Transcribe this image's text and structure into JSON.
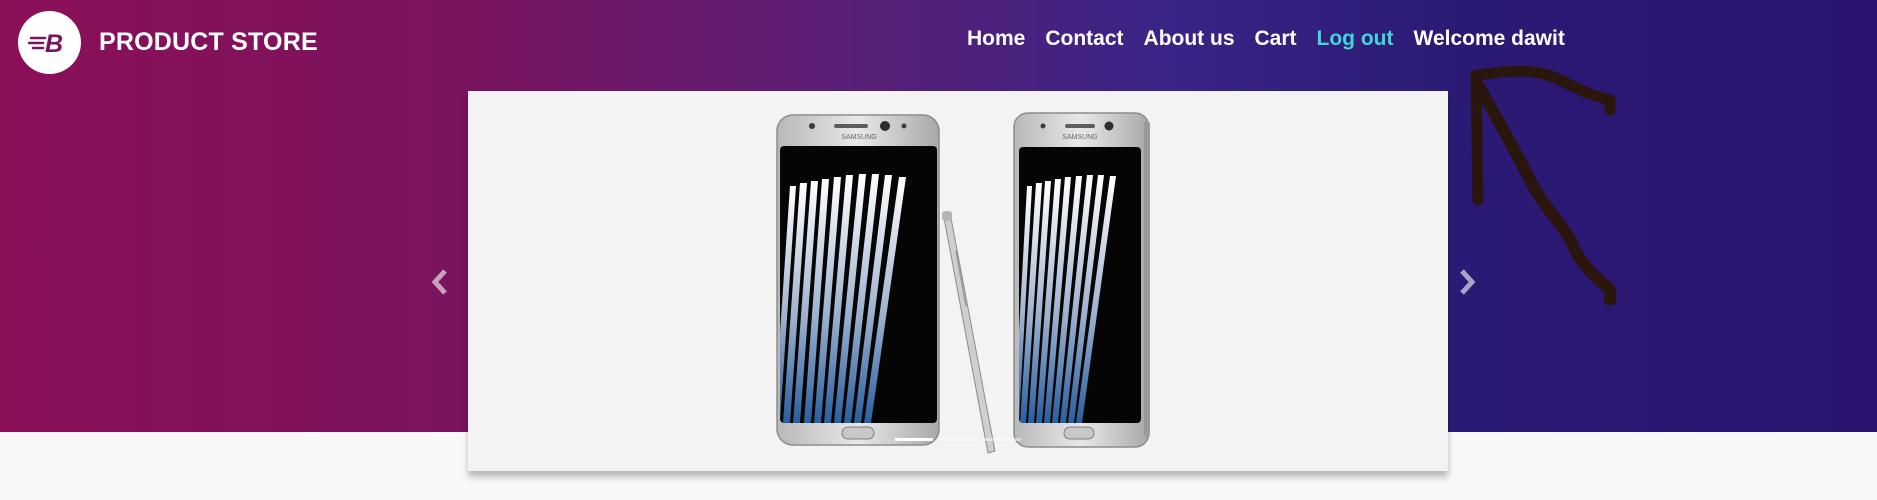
{
  "brand": {
    "name": "PRODUCT STORE",
    "logo_icon": "brand-b-icon",
    "logo_letter": "B"
  },
  "nav": {
    "items": [
      {
        "label": "Home"
      },
      {
        "label": "Contact"
      },
      {
        "label": "About us"
      },
      {
        "label": "Cart"
      },
      {
        "label": "Log out",
        "active": true
      }
    ],
    "welcome": "Welcome dawit"
  },
  "carousel": {
    "slide_brand": "SAMSUNG",
    "prev_icon": "chevron-left-icon",
    "next_icon": "chevron-right-icon",
    "indicators": 3,
    "active_indicator": 1
  },
  "colors": {
    "hero_start": "#8a0f57",
    "hero_end": "#2a1470",
    "active_link": "#3fd6d4",
    "annotation_stroke": "#2a160c"
  }
}
